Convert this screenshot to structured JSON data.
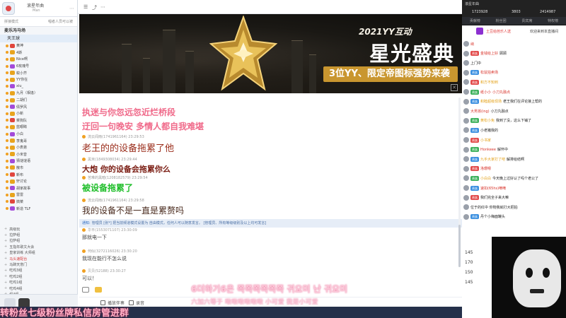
{
  "left": {
    "account_name": "滚星年曲",
    "account_sub": "Man",
    "tabs": [
      "拼接模式",
      "唱者人员可以被"
    ],
    "group_title": "麦乐冯马场",
    "sub_group": "天王球",
    "users": [
      {
        "name": "黄坤",
        "badge": "r"
      },
      {
        "name": "4斯",
        "badge": "o"
      },
      {
        "name": "Nice啊",
        "badge": "o"
      },
      {
        "name": "6玫瑰号",
        "badge": "p"
      },
      {
        "name": "蚊小芥",
        "badge": "o"
      },
      {
        "name": "YY你在",
        "badge": "o"
      },
      {
        "name": "xiu_",
        "badge": "p"
      },
      {
        "name": "九月（相逢）",
        "badge": "o"
      },
      {
        "name": "二胡们",
        "badge": "o"
      },
      {
        "name": "倩罗风",
        "badge": "p"
      },
      {
        "name": "小新",
        "badge": "o"
      },
      {
        "name": "菜狗队",
        "badge": "r"
      },
      {
        "name": "蓝眼睛",
        "badge": "o"
      },
      {
        "name": "小白",
        "badge": "p"
      },
      {
        "name": "李鬼哥",
        "badge": "o"
      },
      {
        "name": "小表弟",
        "badge": "o"
      },
      {
        "name": "小米音",
        "badge": "o"
      },
      {
        "name": "猜谜谜语",
        "badge": "p"
      },
      {
        "name": "散市",
        "badge": "o"
      },
      {
        "name": "新布",
        "badge": "r"
      },
      {
        "name": "轩讨论",
        "badge": "o"
      },
      {
        "name": "胡家故事",
        "badge": "p"
      },
      {
        "name": "雷雷",
        "badge": "o"
      },
      {
        "name": "搞菜",
        "badge": "r"
      },
      {
        "name": "新造 TLF",
        "badge": "p"
      }
    ],
    "categories": [
      {
        "name": "高级玩",
        "red": false
      },
      {
        "name": "拉萨组",
        "red": false
      },
      {
        "name": "拉萨组",
        "red": false
      },
      {
        "name": "五指年歌文大会",
        "red": false
      },
      {
        "name": "皇家训练 大师组",
        "red": false
      },
      {
        "name": "马头速配台",
        "red": true
      },
      {
        "name": "马蹄天意门",
        "red": false
      },
      {
        "name": "吃鸡3组",
        "red": false
      },
      {
        "name": "吃鸡2组",
        "red": false
      },
      {
        "name": "吃鸡1组",
        "red": false
      },
      {
        "name": "吃鸡4组",
        "red": false
      },
      {
        "name": "组4组",
        "red": false
      },
      {
        "name": "吃鸡5组",
        "red": false
      }
    ]
  },
  "banner": {
    "year_title": "2021YY互动",
    "main_title": "星光盛典",
    "subtitle": "3位YY、限定帝图标强势来袭"
  },
  "chat": {
    "messages": [
      {
        "meta": "",
        "text": "执迷与你忽远忽近烂桥段",
        "style": "pink"
      },
      {
        "meta": "",
        "text": "迂回一句晚安 多情人都自我难堪",
        "style": "pink"
      },
      {
        "meta": "流云闻雨(1741961164)  23:29:53",
        "text": "老王的的设备拖累了他",
        "style": "brown"
      },
      {
        "meta": "黑米(1849308034)  23:29:44",
        "text": "大炮 你的设备会拖累你么",
        "style": "dark"
      },
      {
        "meta": "苦难的黑暗(1208182579)  23:29:54",
        "text": "被设备拖累了",
        "style": "green"
      },
      {
        "meta": "流云闻雨(1741961164)  23:29:58",
        "text": "我的设备不是一直是累赘吗",
        "style": "black"
      },
      {
        "meta": "华平(1553071107)  23:30:09",
        "text": "那就电一下",
        "style": "small"
      },
      {
        "meta": "何似(3272116026)  23:30:20",
        "text": "我现在能行不怎么说",
        "style": "small"
      },
      {
        "meta": "贝贝(52188)  23:30:27",
        "text": "可以！",
        "style": "small"
      }
    ],
    "system_prefix": "通知:",
    "system_text": "管理员 [张*] 把当前频道模式设置为 自由模式，任何人可以随意发言。 [管理员、所有等级级别及以上均可发言]"
  },
  "overlay": {
    "line1": "6더하기6은 쪽쪽쪽쪽쪽쪽 귀요미 난 귀요미",
    "line2": "六加六等于 啾啾啾啾啾啾 小可爱 我是小可爱"
  },
  "footer": {
    "item1": "播放伴奏",
    "item2": "录音"
  },
  "bottom_banner": "转粉丝七级粉丝牌私信房管进群",
  "right": {
    "header_title": "滚星年曲",
    "stats": [
      "1723928",
      "3803",
      "2414987"
    ],
    "tabs": [
      "贡献榜",
      "粉丝团",
      "贵宾席",
      "特权榜"
    ],
    "gift_text": "土豆给芭乐人送",
    "gift_text2": "欢迎来到本直播间",
    "comments": [
      {
        "tag": "",
        "name": "",
        "content": "纳"
      },
      {
        "tag": "贵族",
        "name": "金钱给上好",
        "content": "顾顾"
      },
      {
        "tag": "",
        "name": "",
        "content": "上门中"
      },
      {
        "tag": "贵族",
        "name": "松鼠拍卖场",
        "content": ""
      },
      {
        "tag": "贵族",
        "name": "和方不知到",
        "content": ""
      },
      {
        "tag": "贵族",
        "name": "纸小小",
        "content": "小刀丸融点"
      },
      {
        "tag": "贵族",
        "name": "和睦超级现场",
        "content": "老王我们在评论接上帮的"
      },
      {
        "tag": "",
        "name": "大男孩(ing)",
        "content": "小刀丸融点"
      },
      {
        "tag": "贵族",
        "name": "黄松小免",
        "content": "我到了没，这么下铺了"
      },
      {
        "tag": "贵族",
        "name": "",
        "content": "小老猪我的"
      },
      {
        "tag": "贵族",
        "name": "小书家",
        "content": ""
      },
      {
        "tag": "贵族",
        "name": "Honkeee",
        "content": "解怀中"
      },
      {
        "tag": "贵族",
        "name": "九手大家打了吧",
        "content": "解排给结啊"
      },
      {
        "tag": "贵族",
        "name": "洛珊嗯",
        "content": ""
      },
      {
        "tag": "贵族",
        "name": "小白白",
        "content": "今天晚上过好认了吗个老公了"
      },
      {
        "tag": "贵族",
        "name": "",
        "content": "速扣(65hs)嘀嘀"
      },
      {
        "tag": "贵族",
        "name": "",
        "content": "我们完全子来大嘛"
      },
      {
        "tag": "",
        "name": "",
        "content": "位于的红中 你物我就打大把拍"
      },
      {
        "tag": "贵族",
        "name": "",
        "content": "丹个小梅面罐头"
      }
    ],
    "side_numbers": [
      "145",
      "170",
      "150",
      "145"
    ]
  }
}
